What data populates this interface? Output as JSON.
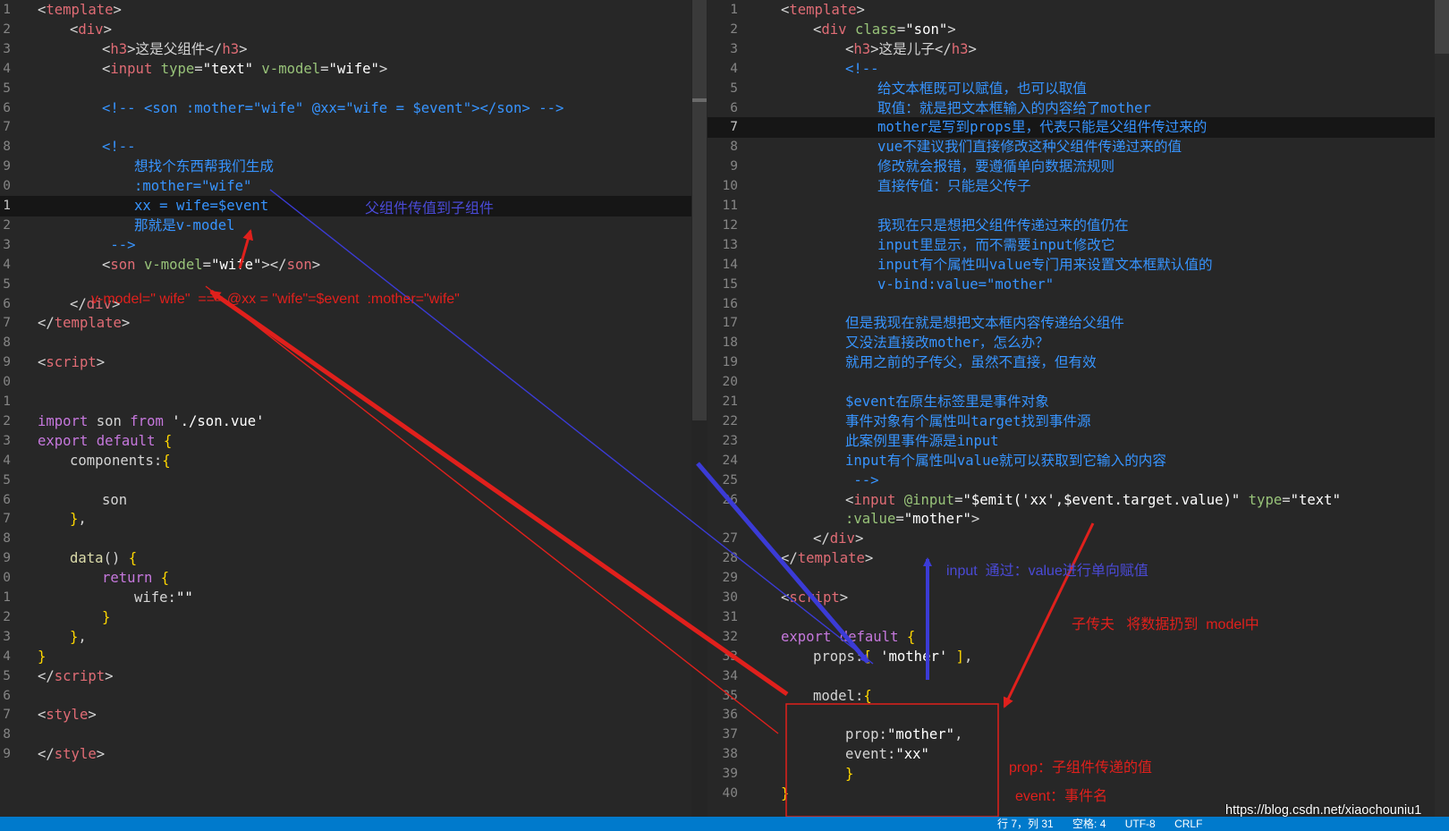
{
  "colors": {
    "background": "#272727",
    "tag": "#e06c75",
    "keyword": "#c678dd",
    "attribute": "#98c379",
    "string": "#ffffff",
    "comment": "#3794ff",
    "text": "#d4d4d4",
    "annotation_blue": "#4a4ad6",
    "annotation_red": "#e0201c",
    "status_bar": "#007acc"
  },
  "left_editor": {
    "current_line": 11,
    "lines": [
      {
        "n": "1",
        "indent": 0,
        "tokens": [
          [
            "<",
            "p"
          ],
          [
            "template",
            "t"
          ],
          [
            ">",
            "p"
          ]
        ]
      },
      {
        "n": "2",
        "indent": 1,
        "tokens": [
          [
            "<",
            "p"
          ],
          [
            "div",
            "t"
          ],
          [
            ">",
            "p"
          ]
        ]
      },
      {
        "n": "3",
        "indent": 2,
        "tokens": [
          [
            "<",
            "p"
          ],
          [
            "h3",
            "t"
          ],
          [
            ">这是父组件</",
            "p"
          ],
          [
            "h3",
            "t"
          ],
          [
            ">",
            "p"
          ]
        ]
      },
      {
        "n": "4",
        "indent": 2,
        "tokens": [
          [
            "<",
            "p"
          ],
          [
            "input",
            "t"
          ],
          [
            " ",
            "p"
          ],
          [
            "type",
            "a"
          ],
          [
            "=",
            "p"
          ],
          [
            "\"text\"",
            "s"
          ],
          [
            " ",
            "p"
          ],
          [
            "v-model",
            "a"
          ],
          [
            "=",
            "p"
          ],
          [
            "\"wife\"",
            "s"
          ],
          [
            ">",
            "p"
          ]
        ]
      },
      {
        "n": "5",
        "indent": 0,
        "tokens": []
      },
      {
        "n": "6",
        "indent": 2,
        "tokens": [
          [
            "<!-- <son :mother=\"wife\" @xx=\"wife = $event\"></son> -->",
            "c"
          ]
        ]
      },
      {
        "n": "7",
        "indent": 0,
        "tokens": []
      },
      {
        "n": "8",
        "indent": 2,
        "tokens": [
          [
            "<!--",
            "c"
          ]
        ]
      },
      {
        "n": "9",
        "indent": 3,
        "tokens": [
          [
            "想找个东西帮我们生成",
            "c"
          ]
        ]
      },
      {
        "n": "0",
        "indent": 3,
        "tokens": [
          [
            ":mother=\"wife\"",
            "c"
          ]
        ]
      },
      {
        "n": "1",
        "indent": 3,
        "tokens": [
          [
            "xx = wife=$event",
            "c"
          ]
        ]
      },
      {
        "n": "2",
        "indent": 3,
        "tokens": [
          [
            "那就是v-model",
            "c"
          ]
        ]
      },
      {
        "n": "3",
        "indent": 2,
        "tokens": [
          [
            " -->",
            "c"
          ]
        ]
      },
      {
        "n": "4",
        "indent": 2,
        "tokens": [
          [
            "<",
            "p"
          ],
          [
            "son",
            "t"
          ],
          [
            " ",
            "p"
          ],
          [
            "v-model",
            "a"
          ],
          [
            "=",
            "p"
          ],
          [
            "\"wife\"",
            "s"
          ],
          [
            "></",
            "p"
          ],
          [
            "son",
            "t"
          ],
          [
            ">",
            "p"
          ]
        ]
      },
      {
        "n": "5",
        "indent": 0,
        "tokens": []
      },
      {
        "n": "6",
        "indent": 1,
        "tokens": [
          [
            "</",
            "p"
          ],
          [
            "div",
            "t"
          ],
          [
            ">",
            "p"
          ]
        ]
      },
      {
        "n": "7",
        "indent": 0,
        "tokens": [
          [
            "</",
            "p"
          ],
          [
            "template",
            "t"
          ],
          [
            ">",
            "p"
          ]
        ]
      },
      {
        "n": "8",
        "indent": 0,
        "tokens": []
      },
      {
        "n": "9",
        "indent": 0,
        "tokens": [
          [
            "<",
            "p"
          ],
          [
            "script",
            "t"
          ],
          [
            ">",
            "p"
          ]
        ]
      },
      {
        "n": "0",
        "indent": 0,
        "tokens": []
      },
      {
        "n": "1",
        "indent": 0,
        "tokens": []
      },
      {
        "n": "2",
        "indent": 0,
        "tokens": [
          [
            "import",
            "k"
          ],
          [
            " son ",
            "p"
          ],
          [
            "from",
            "k"
          ],
          [
            " ",
            "p"
          ],
          [
            "'./son.vue'",
            "s"
          ]
        ]
      },
      {
        "n": "3",
        "indent": 0,
        "tokens": [
          [
            "export",
            "k"
          ],
          [
            " ",
            "p"
          ],
          [
            "default",
            "k"
          ],
          [
            " {",
            "y"
          ]
        ]
      },
      {
        "n": "4",
        "indent": 1,
        "tokens": [
          [
            "components:",
            "p"
          ],
          [
            "{",
            "y"
          ]
        ]
      },
      {
        "n": "5",
        "indent": 0,
        "tokens": []
      },
      {
        "n": "6",
        "indent": 2,
        "tokens": [
          [
            "son",
            "p"
          ]
        ]
      },
      {
        "n": "7",
        "indent": 1,
        "tokens": [
          [
            "}",
            "y"
          ],
          [
            ",",
            "p"
          ]
        ]
      },
      {
        "n": "8",
        "indent": 0,
        "tokens": []
      },
      {
        "n": "9",
        "indent": 1,
        "tokens": [
          [
            "data",
            "f"
          ],
          [
            "() ",
            "p"
          ],
          [
            "{",
            "y"
          ]
        ]
      },
      {
        "n": "0",
        "indent": 2,
        "tokens": [
          [
            "return",
            "k"
          ],
          [
            " ",
            "p"
          ],
          [
            "{",
            "y"
          ]
        ]
      },
      {
        "n": "1",
        "indent": 3,
        "tokens": [
          [
            "wife:",
            "p"
          ],
          [
            "\"\"",
            "s"
          ]
        ]
      },
      {
        "n": "2",
        "indent": 2,
        "tokens": [
          [
            "}",
            "y"
          ]
        ]
      },
      {
        "n": "3",
        "indent": 1,
        "tokens": [
          [
            "}",
            "y"
          ],
          [
            ",",
            "p"
          ]
        ]
      },
      {
        "n": "4",
        "indent": 0,
        "tokens": [
          [
            "}",
            "y"
          ]
        ]
      },
      {
        "n": "5",
        "indent": 0,
        "tokens": [
          [
            "</",
            "p"
          ],
          [
            "script",
            "t"
          ],
          [
            ">",
            "p"
          ]
        ]
      },
      {
        "n": "6",
        "indent": 0,
        "tokens": []
      },
      {
        "n": "7",
        "indent": 0,
        "tokens": [
          [
            "<",
            "p"
          ],
          [
            "style",
            "t"
          ],
          [
            ">",
            "p"
          ]
        ]
      },
      {
        "n": "8",
        "indent": 0,
        "tokens": []
      },
      {
        "n": "9",
        "indent": 0,
        "tokens": [
          [
            "</",
            "p"
          ],
          [
            "style",
            "t"
          ],
          [
            ">",
            "p"
          ]
        ]
      }
    ]
  },
  "right_editor": {
    "current_line": 7,
    "lines": [
      {
        "n": "1",
        "indent": 0,
        "tokens": [
          [
            "<",
            "p"
          ],
          [
            "template",
            "t"
          ],
          [
            ">",
            "p"
          ]
        ]
      },
      {
        "n": "2",
        "indent": 1,
        "tokens": [
          [
            "<",
            "p"
          ],
          [
            "div",
            "t"
          ],
          [
            " ",
            "p"
          ],
          [
            "class",
            "a"
          ],
          [
            "=",
            "p"
          ],
          [
            "\"son\"",
            "s"
          ],
          [
            ">",
            "p"
          ]
        ]
      },
      {
        "n": "3",
        "indent": 2,
        "tokens": [
          [
            "<",
            "p"
          ],
          [
            "h3",
            "t"
          ],
          [
            ">这是儿子</",
            "p"
          ],
          [
            "h3",
            "t"
          ],
          [
            ">",
            "p"
          ]
        ]
      },
      {
        "n": "4",
        "indent": 2,
        "tokens": [
          [
            "<!--",
            "c"
          ]
        ]
      },
      {
        "n": "5",
        "indent": 3,
        "tokens": [
          [
            "给文本框既可以赋值，也可以取值",
            "c"
          ]
        ]
      },
      {
        "n": "6",
        "indent": 3,
        "tokens": [
          [
            "取值：就是把文本框输入的内容给了mother",
            "c"
          ]
        ]
      },
      {
        "n": "7",
        "indent": 3,
        "tokens": [
          [
            "mother是写到props里，代表只能是父组件传过来的",
            "c"
          ]
        ]
      },
      {
        "n": "8",
        "indent": 3,
        "tokens": [
          [
            "vue不建议我们直接修改这种父组件传递过来的值",
            "c"
          ]
        ]
      },
      {
        "n": "9",
        "indent": 3,
        "tokens": [
          [
            "修改就会报错，要遵循单向数据流规则",
            "c"
          ]
        ]
      },
      {
        "n": "10",
        "indent": 3,
        "tokens": [
          [
            "直接传值：只能是父传子",
            "c"
          ]
        ]
      },
      {
        "n": "11",
        "indent": 0,
        "tokens": []
      },
      {
        "n": "12",
        "indent": 3,
        "tokens": [
          [
            "我现在只是想把父组件传递过来的值仍在",
            "c"
          ]
        ]
      },
      {
        "n": "13",
        "indent": 3,
        "tokens": [
          [
            "input里显示，而不需要input修改它",
            "c"
          ]
        ]
      },
      {
        "n": "14",
        "indent": 3,
        "tokens": [
          [
            "input有个属性叫value专门用来设置文本框默认值的",
            "c"
          ]
        ]
      },
      {
        "n": "15",
        "indent": 3,
        "tokens": [
          [
            "v-bind:value=\"mother\"",
            "c"
          ]
        ]
      },
      {
        "n": "16",
        "indent": 0,
        "tokens": []
      },
      {
        "n": "17",
        "indent": 2,
        "tokens": [
          [
            "但是我现在就是想把文本框内容传递给父组件",
            "c"
          ]
        ]
      },
      {
        "n": "18",
        "indent": 2,
        "tokens": [
          [
            "又没法直接改mother，怎么办？",
            "c"
          ]
        ]
      },
      {
        "n": "19",
        "indent": 2,
        "tokens": [
          [
            "就用之前的子传父，虽然不直接，但有效",
            "c"
          ]
        ]
      },
      {
        "n": "20",
        "indent": 0,
        "tokens": []
      },
      {
        "n": "21",
        "indent": 2,
        "tokens": [
          [
            "$event在原生标签里是事件对象",
            "c"
          ]
        ]
      },
      {
        "n": "22",
        "indent": 2,
        "tokens": [
          [
            "事件对象有个属性叫target找到事件源",
            "c"
          ]
        ]
      },
      {
        "n": "23",
        "indent": 2,
        "tokens": [
          [
            "此案例里事件源是input",
            "c"
          ]
        ]
      },
      {
        "n": "24",
        "indent": 2,
        "tokens": [
          [
            "input有个属性叫value就可以获取到它输入的内容",
            "c"
          ]
        ]
      },
      {
        "n": "25",
        "indent": 2,
        "tokens": [
          [
            " -->",
            "c"
          ]
        ]
      },
      {
        "n": "26",
        "indent": 2,
        "tokens": [
          [
            "<",
            "p"
          ],
          [
            "input",
            "t"
          ],
          [
            " ",
            "p"
          ],
          [
            "@input",
            "a"
          ],
          [
            "=",
            "p"
          ],
          [
            "\"$emit('xx',$event.target.value)\"",
            "s"
          ],
          [
            " ",
            "p"
          ],
          [
            "type",
            "a"
          ],
          [
            "=",
            "p"
          ],
          [
            "\"text\"",
            "s"
          ]
        ]
      },
      {
        "n": "",
        "indent": 2,
        "tokens": [
          [
            ":value",
            "a"
          ],
          [
            "=",
            "p"
          ],
          [
            "\"mother\"",
            "s"
          ],
          [
            ">",
            "p"
          ]
        ]
      },
      {
        "n": "27",
        "indent": 1,
        "tokens": [
          [
            "</",
            "p"
          ],
          [
            "div",
            "t"
          ],
          [
            ">",
            "p"
          ]
        ]
      },
      {
        "n": "28",
        "indent": 0,
        "tokens": [
          [
            "</",
            "p"
          ],
          [
            "template",
            "t"
          ],
          [
            ">",
            "p"
          ]
        ]
      },
      {
        "n": "29",
        "indent": 0,
        "tokens": []
      },
      {
        "n": "30",
        "indent": 0,
        "tokens": [
          [
            "<",
            "p"
          ],
          [
            "script",
            "t"
          ],
          [
            ">",
            "p"
          ]
        ]
      },
      {
        "n": "31",
        "indent": 0,
        "tokens": []
      },
      {
        "n": "32",
        "indent": 0,
        "tokens": [
          [
            "export",
            "k"
          ],
          [
            " ",
            "p"
          ],
          [
            "default",
            "k"
          ],
          [
            " {",
            "y"
          ]
        ]
      },
      {
        "n": "33",
        "indent": 1,
        "tokens": [
          [
            "props:",
            "p"
          ],
          [
            "[ ",
            "y"
          ],
          [
            "'mother'",
            "s"
          ],
          [
            " ]",
            "y"
          ],
          [
            ",",
            "p"
          ]
        ]
      },
      {
        "n": "34",
        "indent": 0,
        "tokens": []
      },
      {
        "n": "35",
        "indent": 1,
        "tokens": [
          [
            "model:",
            "p"
          ],
          [
            "{",
            "y"
          ]
        ]
      },
      {
        "n": "36",
        "indent": 0,
        "tokens": []
      },
      {
        "n": "37",
        "indent": 2,
        "tokens": [
          [
            "prop:",
            "p"
          ],
          [
            "\"mother\"",
            "s"
          ],
          [
            ",",
            "p"
          ]
        ]
      },
      {
        "n": "38",
        "indent": 2,
        "tokens": [
          [
            "event:",
            "p"
          ],
          [
            "\"xx\"",
            "s"
          ]
        ]
      },
      {
        "n": "39",
        "indent": 2,
        "tokens": [
          [
            "}",
            "y"
          ]
        ]
      },
      {
        "n": "40",
        "indent": 0,
        "tokens": [
          [
            "}",
            "y"
          ]
        ]
      }
    ]
  },
  "annotations": {
    "parent_to_child": "父组件传值到子组件",
    "vmodel_equivalence": "v-model=\" wife\"  === @xx = \"wife\"=$event  :mother=\"wife\"",
    "input_value_assign": "input  通过：value进行单向赋值",
    "child_to_parent": "子传夫   将数据扔到  model中",
    "prop_desc": "prop：子组件传递的值",
    "event_desc": "event：事件名"
  },
  "watermark": "https://blog.csdn.net/xiaochouniu1",
  "status_bar": {
    "position": "行 7，列 31",
    "spaces": "空格: 4",
    "encoding": "UTF-8",
    "eol": "CRLF"
  }
}
